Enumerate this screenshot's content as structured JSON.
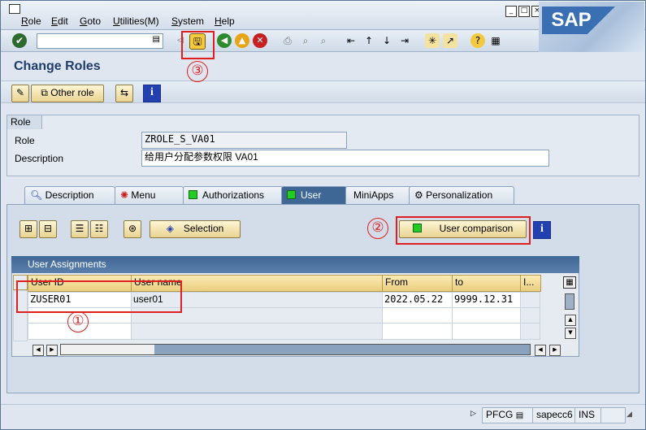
{
  "menu": {
    "items": [
      "Role",
      "Edit",
      "Goto",
      "Utilities(M)",
      "System",
      "Help"
    ]
  },
  "brand": {
    "logo_text": "SAP",
    "accent": "#3a6fb4"
  },
  "toolbar": {
    "command_field_value": "",
    "icons": [
      "enter-icon",
      "save-icon",
      "back-icon",
      "exit-icon",
      "cancel-icon",
      "print-icon",
      "find-icon",
      "find-next-icon",
      "first-page-icon",
      "previous-page-icon",
      "next-page-icon",
      "last-page-icon",
      "create-session-icon",
      "shortcut-icon",
      "help-icon",
      "layout-icon"
    ]
  },
  "page": {
    "title": "Change Roles"
  },
  "app_toolbar": {
    "other_role_label": "Other role"
  },
  "role": {
    "group_title": "Role",
    "role_label": "Role",
    "role_value": "ZROLE_S_VA01",
    "description_label": "Description",
    "description_value": "给用户分配参数权限 VA01"
  },
  "tabs": [
    {
      "label": "Description",
      "icon": "magnifier-icon"
    },
    {
      "label": "Menu",
      "icon": "menu-bug-icon"
    },
    {
      "label": "Authorizations",
      "icon": "green-square-icon"
    },
    {
      "label": "User",
      "icon": "green-square-icon",
      "active": true
    },
    {
      "label": "MiniApps",
      "icon": ""
    },
    {
      "label": "Personalization",
      "icon": "personalization-icon"
    }
  ],
  "user_tab": {
    "selection_label": "Selection",
    "user_comparison_label": "User comparison"
  },
  "table": {
    "title": "User Assignments",
    "columns": [
      "User ID",
      "User name",
      "From",
      "to",
      "I..."
    ],
    "rows": [
      {
        "user_id": "ZUSER01",
        "user_name": "user01",
        "from": "2022.05.22",
        "to": "9999.12.31",
        "i": ""
      }
    ]
  },
  "status": {
    "transaction": "PFCG",
    "server": "sapecc6",
    "mode": "INS"
  },
  "annotations": {
    "one": "①",
    "two": "②",
    "three": "③"
  },
  "colors": {
    "annotation_red": "#e02020",
    "active_tab": "#3f6795",
    "green_status": "#22cc22"
  }
}
